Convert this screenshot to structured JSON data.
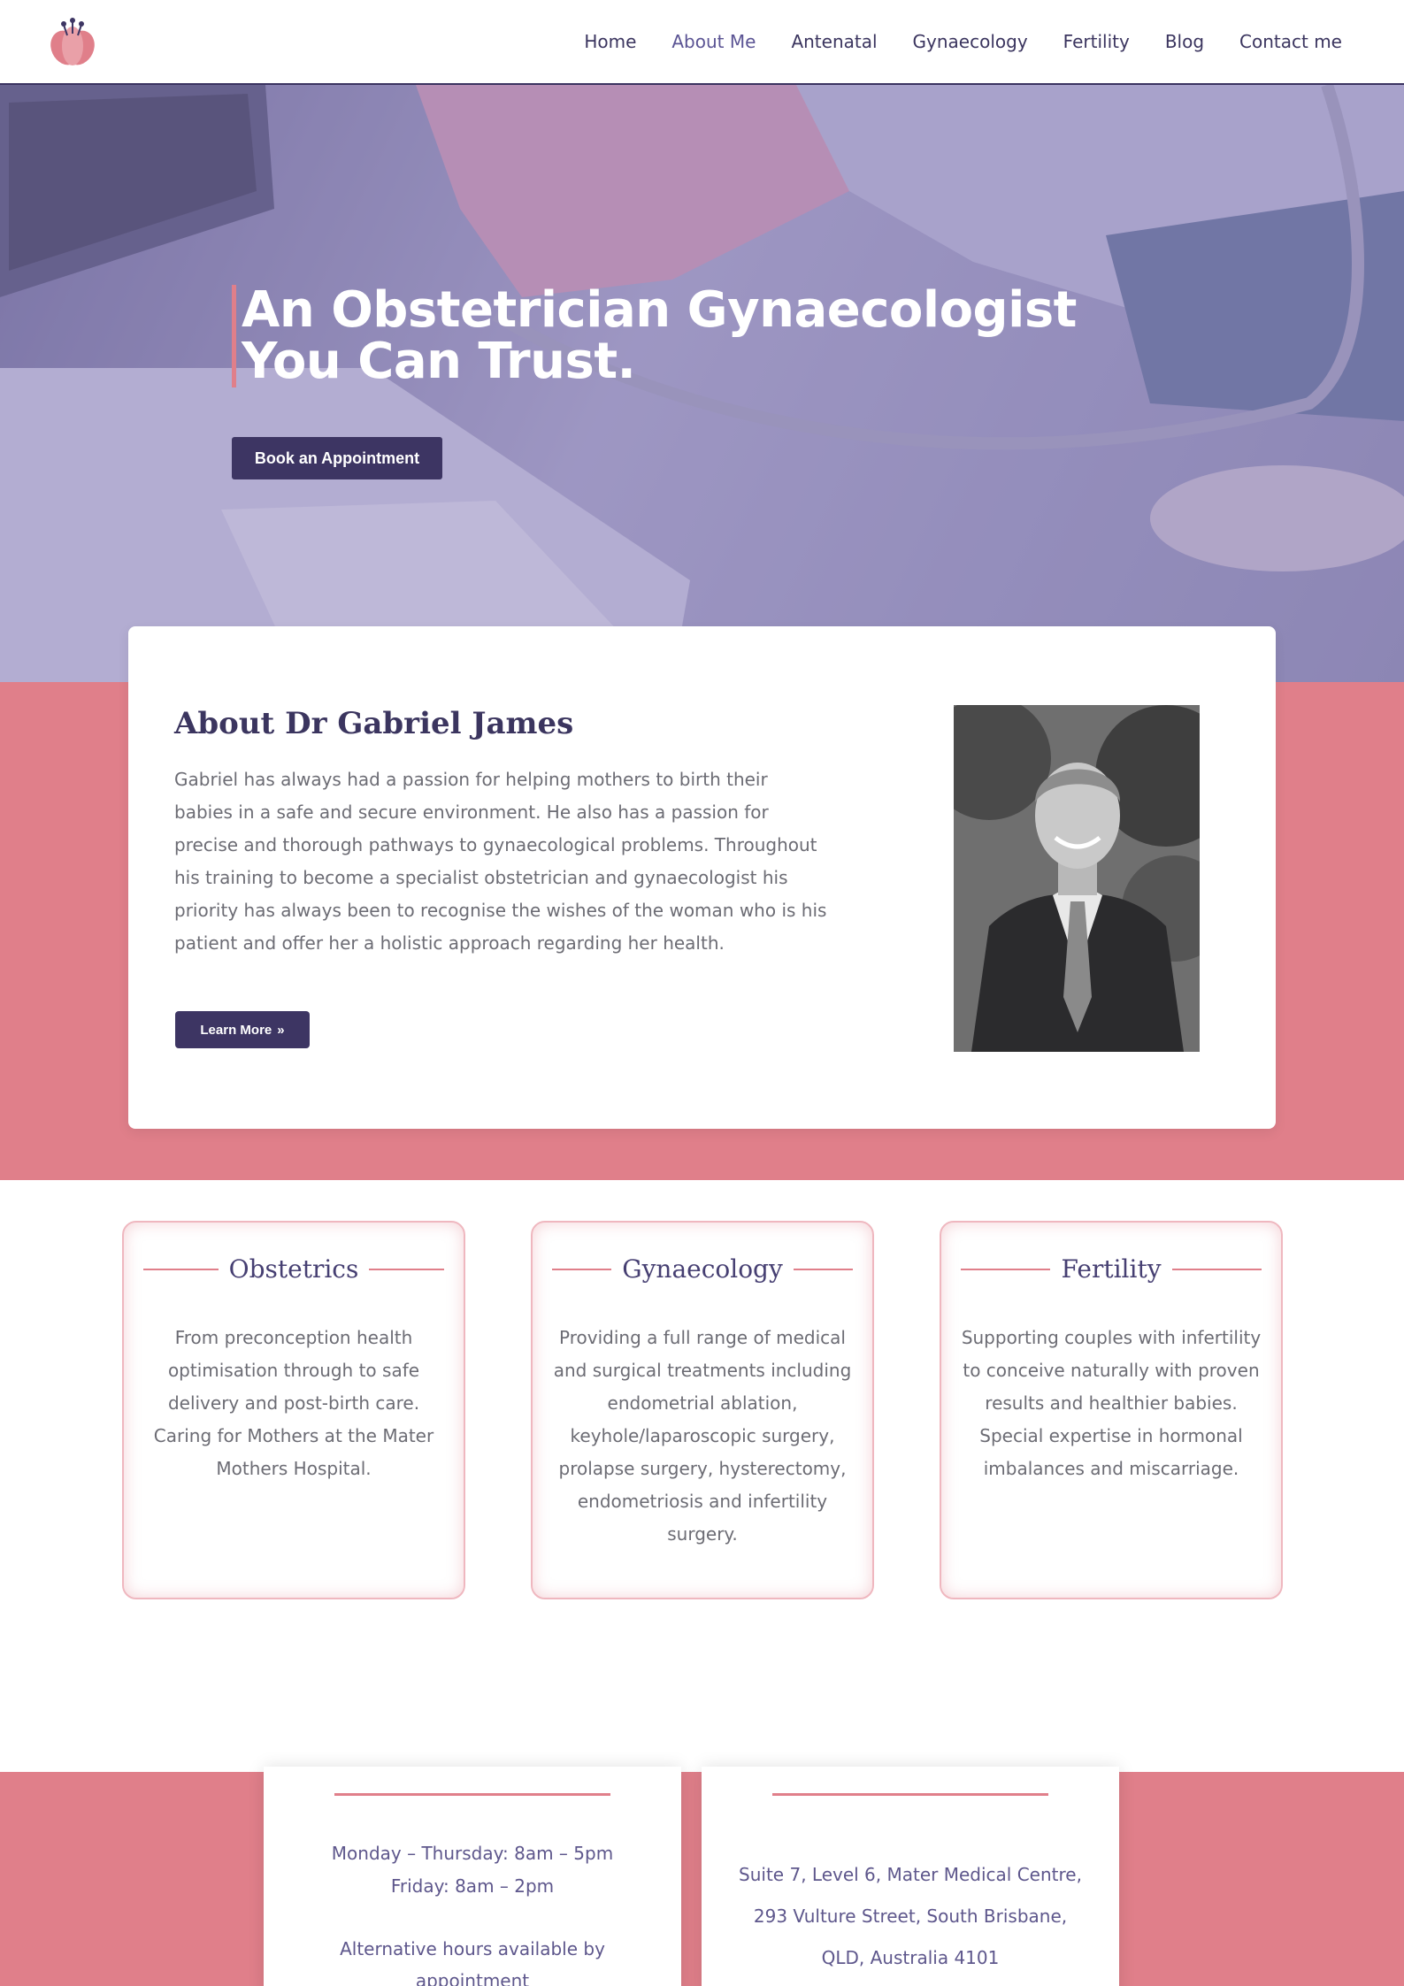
{
  "header": {
    "nav": [
      "Home",
      "About Me",
      "Antenatal",
      "Gynaecology",
      "Fertility",
      "Blog",
      "Contact me"
    ],
    "active": "About Me"
  },
  "hero": {
    "title_line1": "An Obstetrician Gynaecologist",
    "title_line2": "You Can Trust.",
    "cta": "Book an Appointment"
  },
  "about": {
    "title": "About Dr Gabriel James",
    "text": "Gabriel has always had a passion for helping mothers to birth their babies in a safe and secure environment. He also has a passion for precise and thorough pathways to gynaecological problems. Throughout his training to become a specialist obstetrician and gynaecologist his priority has always been to recognise the wishes of the woman who is his patient and offer her a holistic approach regarding her health.",
    "button": "Learn More",
    "button_icon": "double-chevron-right-icon"
  },
  "services": [
    {
      "title": "Obstetrics",
      "text": "From preconception health optimisation through to safe delivery and post-birth care. Caring for Mothers at the Mater Mothers Hospital."
    },
    {
      "title": "Gynaecology",
      "text": "Providing a full range of medical and surgical treatments including endometrial ablation, keyhole/laparoscopic surgery, prolapse surgery, hysterectomy, endometriosis and infertility surgery."
    },
    {
      "title": "Fertility",
      "text": "Supporting couples with infertility to conceive naturally with proven results and healthier babies. Special expertise in hormonal imbalances and miscarriage."
    }
  ],
  "hours": {
    "line1": "Monday – Thursday: 8am – 5pm",
    "line2": "Friday: 8am – 2pm",
    "line3": "Alternative hours available by appointment"
  },
  "address": {
    "line1": "Suite 7, Level 6, Mater Medical Centre,",
    "line2": "293 Vulture Street, South Brisbane,",
    "line3": "QLD, Australia 4101"
  },
  "colors": {
    "brand_pink": "#e07f8a",
    "brand_navy": "#3d3563"
  }
}
